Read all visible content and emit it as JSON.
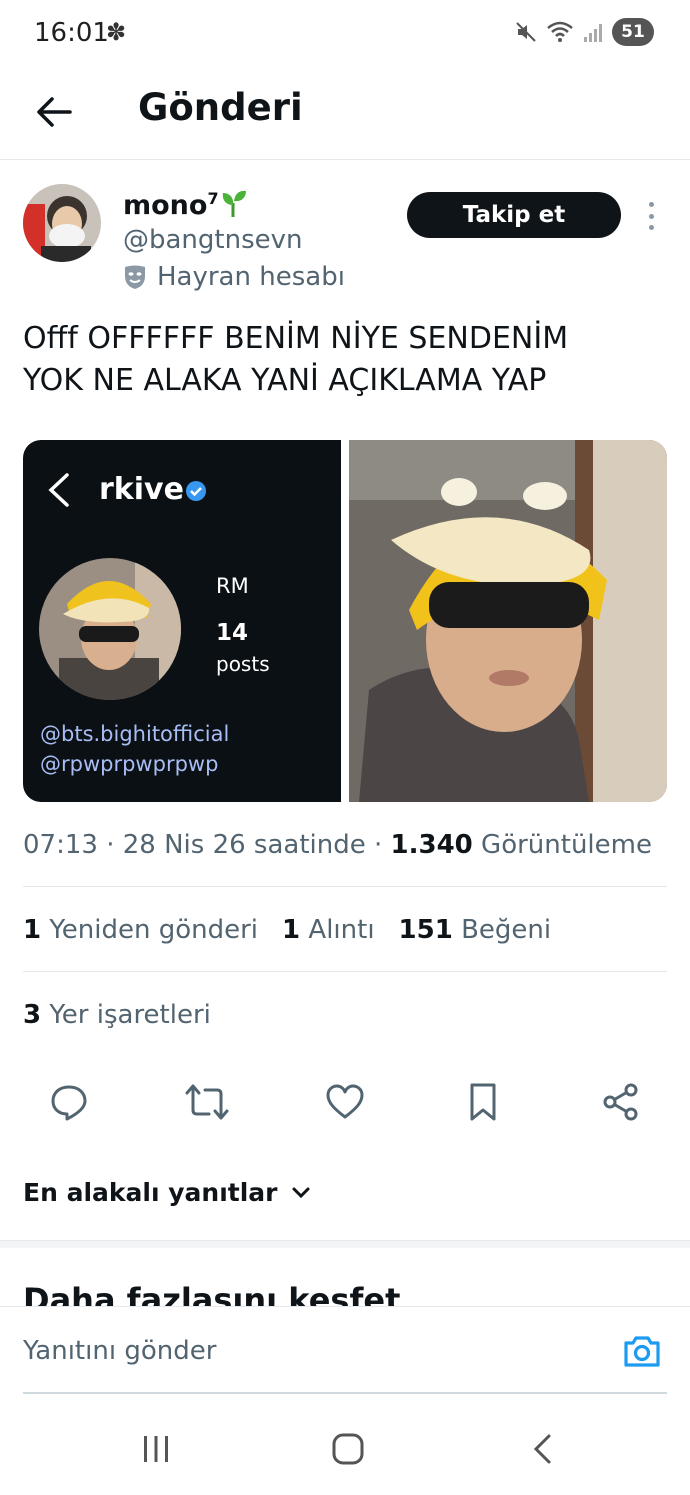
{
  "status_bar": {
    "time": "16:01",
    "battery": "51"
  },
  "header": {
    "title": "Gönderi"
  },
  "post": {
    "author": {
      "display_name": "mono",
      "superscript": "7",
      "handle": "@bangtnsevn",
      "label": "Hayran hesabı"
    },
    "follow_label": "Takip et",
    "text": "Offf OFFFFFF BENİM NİYE SENDENİM\nYOK NE ALAKA YANİ AÇIKLAMA YAP",
    "media": {
      "profile_name": "rkive",
      "stat_name": "RM",
      "posts_count": "14",
      "posts_label": "posts",
      "link1": "@bts.bighitofficial",
      "link2": "@rpwprpwprpwp"
    },
    "meta": {
      "time": "07:13",
      "date": "28 Nis 26 saatinde",
      "views": "1.340",
      "views_label": "Görüntüleme"
    },
    "stats": {
      "reposts": "1",
      "reposts_label": "Yeniden gönderi",
      "quotes": "1",
      "quotes_label": "Alıntı",
      "likes": "151",
      "likes_label": "Beğeni",
      "bookmarks": "3",
      "bookmarks_label": "Yer işaretleri"
    }
  },
  "replies_sort": "En alakalı yanıtlar",
  "explore_title": "Daha fazlasını keşfet",
  "reply": {
    "placeholder": "Yanıtını gönder"
  },
  "colors": {
    "accent": "#1d9bf0",
    "text_primary": "#0f1419",
    "text_secondary": "#536471"
  }
}
